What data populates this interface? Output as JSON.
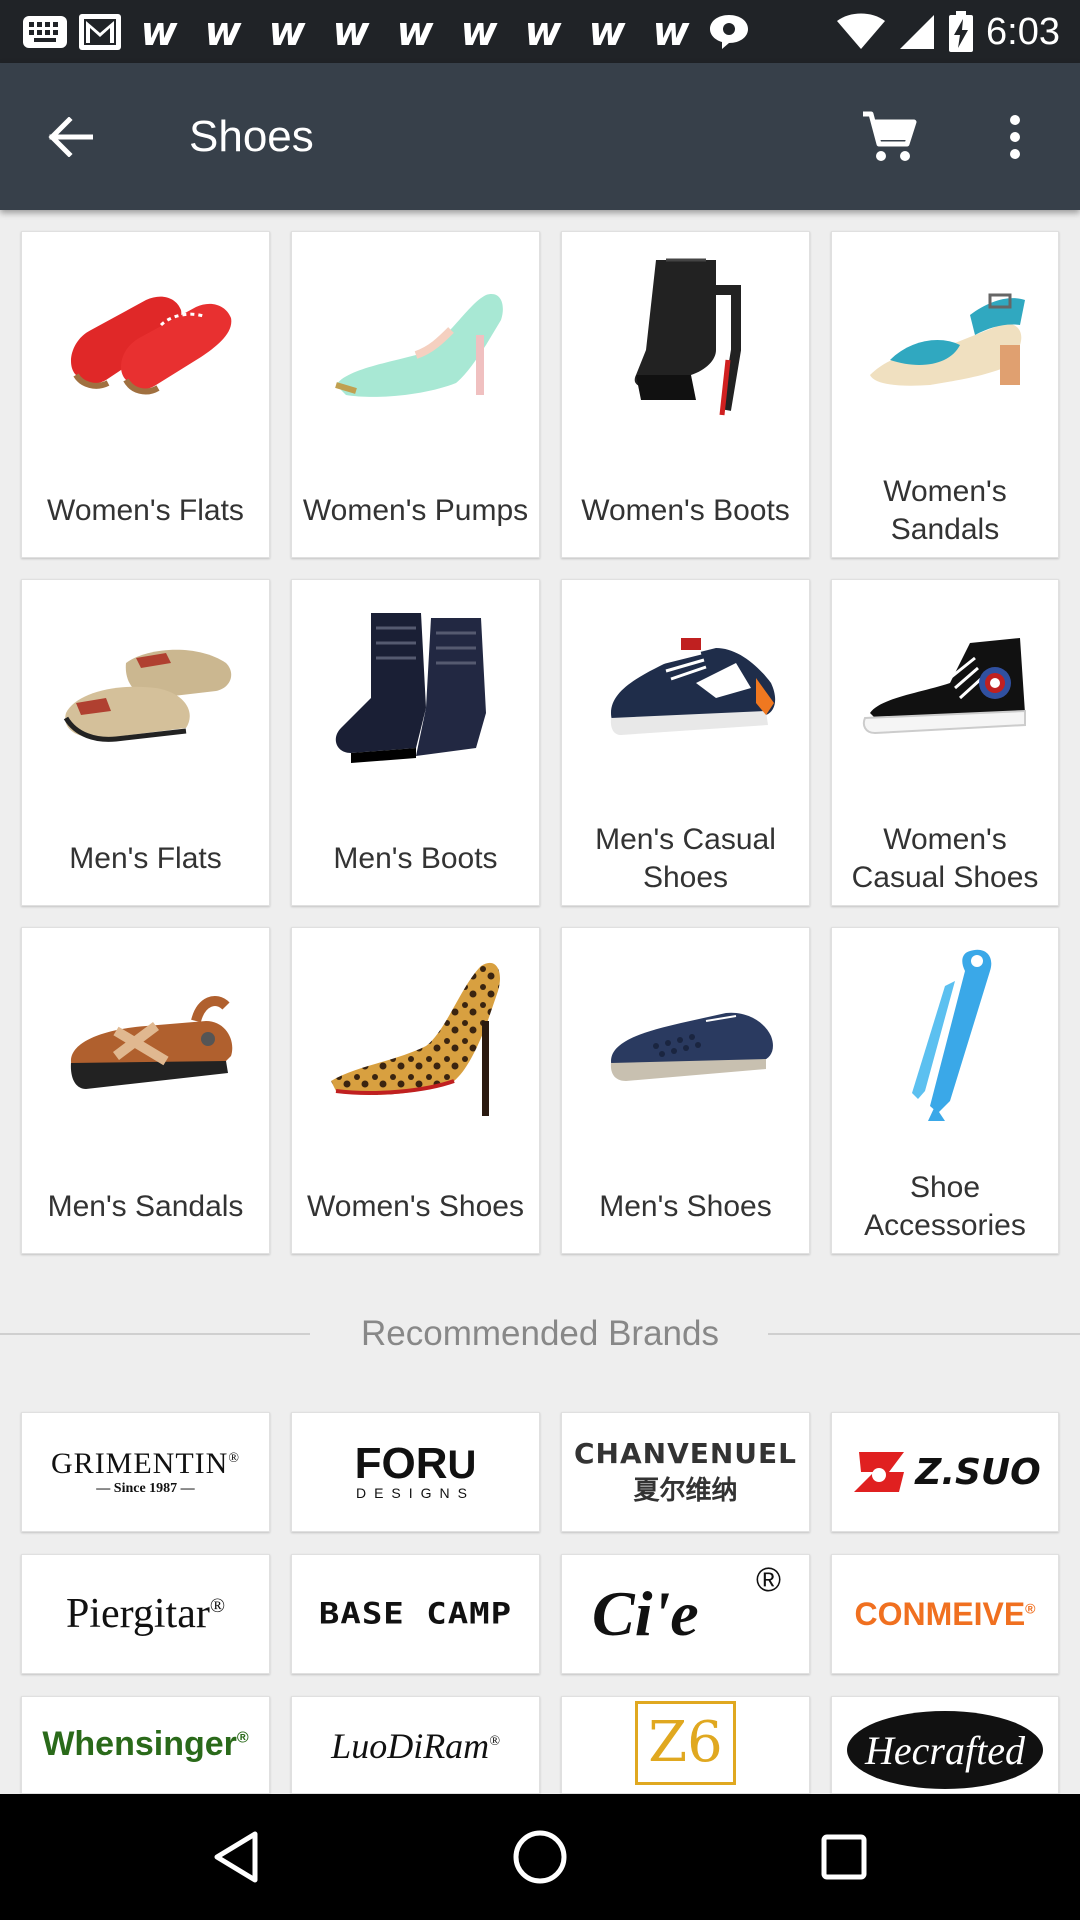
{
  "status_bar": {
    "time": "6:03",
    "notification_icons": [
      "keyboard-icon",
      "gmail-icon",
      "w-icon",
      "w-icon",
      "w-icon",
      "w-icon",
      "w-icon",
      "w-icon",
      "w-icon",
      "w-icon",
      "w-icon",
      "chat-bubble-icon"
    ],
    "w_glyph": "w"
  },
  "app_bar": {
    "title": "Shoes"
  },
  "categories": [
    {
      "label": "Women's Flats",
      "icon": "red-flats"
    },
    {
      "label": "Women's Pumps",
      "icon": "mint-pump"
    },
    {
      "label": "Women's Boots",
      "icon": "black-boot"
    },
    {
      "label": "Women's Sandals",
      "icon": "teal-sandal"
    },
    {
      "label": "Men's Flats",
      "icon": "tan-slipon"
    },
    {
      "label": "Men's Boots",
      "icon": "navy-boots"
    },
    {
      "label": "Men's Casual Shoes",
      "icon": "navy-sneaker"
    },
    {
      "label": "Women's Casual Shoes",
      "icon": "black-hightop"
    },
    {
      "label": "Men's Sandals",
      "icon": "brown-sandal"
    },
    {
      "label": "Women's Shoes",
      "icon": "leopard-heel"
    },
    {
      "label": "Men's Shoes",
      "icon": "blue-loafer"
    },
    {
      "label": "Shoe Accessories",
      "icon": "blue-shoehorn"
    }
  ],
  "brands_section": {
    "title": "Recommended Brands"
  },
  "brands": [
    {
      "name": "GRIMENTIN",
      "sub": "— Since 1987 —",
      "mark": "®"
    },
    {
      "name": "FOR",
      "sub": "DESIGNS",
      "mark": "U"
    },
    {
      "name": "CHANVENUEL",
      "sub": "夏尔维纳",
      "mark": ""
    },
    {
      "name": "Z.SUO",
      "sub": "",
      "mark": ""
    },
    {
      "name": "Piergitar",
      "sub": "",
      "mark": "®"
    },
    {
      "name": "BASE CAMP",
      "sub": "",
      "mark": ""
    },
    {
      "name": "Ci'e",
      "sub": "",
      "mark": "®"
    },
    {
      "name": "CONMEIVE",
      "sub": "",
      "mark": "®"
    },
    {
      "name": "Whensinger",
      "sub": "",
      "mark": "®"
    },
    {
      "name": "LuoDiRam",
      "sub": "",
      "mark": "®"
    },
    {
      "name": "Z6",
      "sub": "",
      "mark": ""
    },
    {
      "name": "Hecrafted",
      "sub": "",
      "mark": ""
    }
  ],
  "colors": {
    "status_bar": "#202327",
    "app_bar": "#37404a",
    "background": "#eeeeee",
    "nav_bar": "#000000"
  }
}
